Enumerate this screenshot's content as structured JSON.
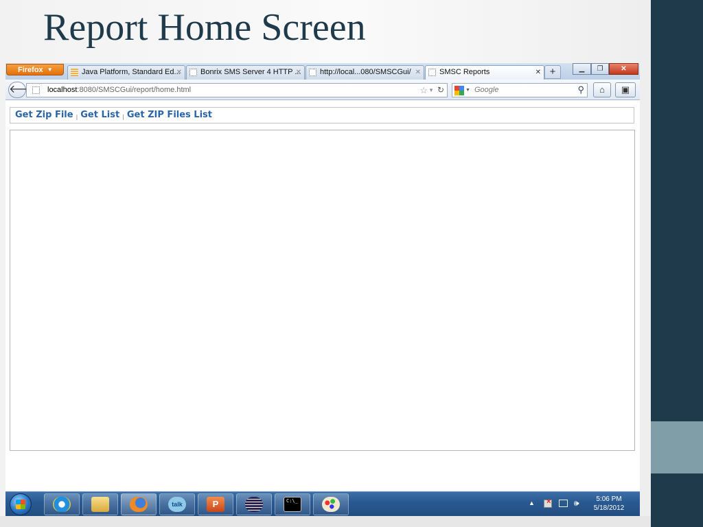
{
  "slide": {
    "title": "Report Home Screen"
  },
  "browser": {
    "menu_button": "Firefox",
    "tabs": [
      {
        "label": "Java Platform, Standard Ed...",
        "active": false
      },
      {
        "label": "Bonrix SMS Server 4 HTTP ...",
        "active": false
      },
      {
        "label": "http://local...080/SMSCGui/",
        "active": false
      },
      {
        "label": "SMSC Reports",
        "active": true
      }
    ],
    "new_tab_symbol": "+",
    "url_host": "localhost",
    "url_rest": ":8080/SMSCGui/report/home.html",
    "search_placeholder": "Google"
  },
  "page": {
    "links": [
      "Get Zip File",
      "Get List",
      "Get ZIP Files List"
    ],
    "separator": "|"
  },
  "taskbar": {
    "apps": [
      "internet-explorer",
      "windows-explorer",
      "firefox",
      "google-talk",
      "powerpoint",
      "eclipse",
      "command-prompt",
      "paint"
    ],
    "clock_time": "5:06 PM",
    "clock_date": "5/18/2012",
    "talk_label": "talk",
    "ppt_label": "P",
    "cmd_label": "C:\\_"
  },
  "colors": {
    "slide_title": "#1f3a4a",
    "side_bar": "#1f3a4a",
    "side_block": "#7f9ea8",
    "link": "#2a64a9"
  }
}
